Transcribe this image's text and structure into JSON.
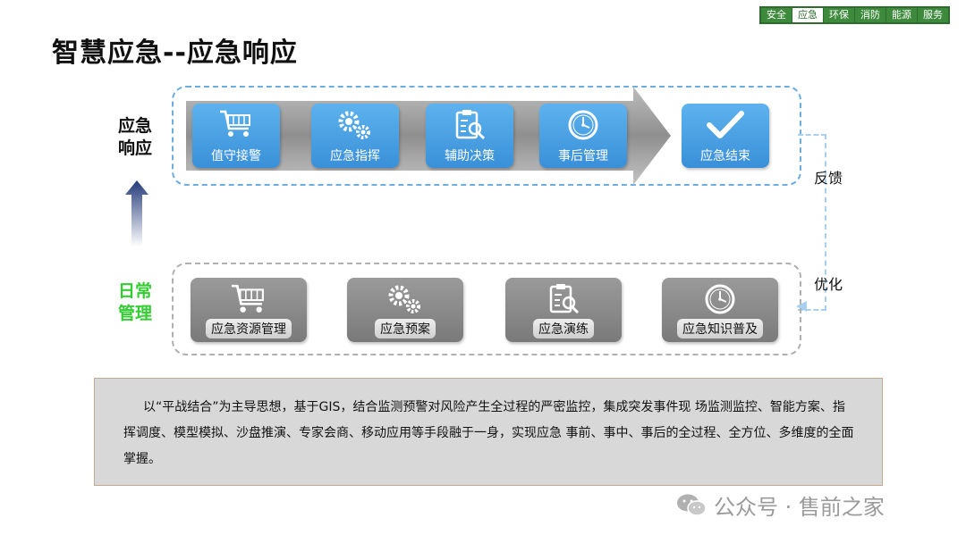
{
  "header": {
    "title": "智慧应急--应急响应",
    "tabs": [
      "安全",
      "应急",
      "环保",
      "消防",
      "能源",
      "服务"
    ],
    "active_tab": "应急"
  },
  "response": {
    "label_line1": "应急",
    "label_line2": "响应",
    "steps": [
      {
        "label": "值守接警",
        "icon": "shopping-cart-icon"
      },
      {
        "label": "应急指挥",
        "icon": "gears-icon"
      },
      {
        "label": "辅助决策",
        "icon": "clipboard-search-icon"
      },
      {
        "label": "事后管理",
        "icon": "clock-icon"
      },
      {
        "label": "应急结束",
        "icon": "checkmark-icon"
      }
    ]
  },
  "daily": {
    "label_line1": "日常",
    "label_line2": "管理",
    "steps": [
      {
        "label": "应急资源管理",
        "icon": "shopping-cart-icon"
      },
      {
        "label": "应急预案",
        "icon": "gears-icon"
      },
      {
        "label": "应急演练",
        "icon": "clipboard-search-icon"
      },
      {
        "label": "应急知识普及",
        "icon": "clock-icon"
      }
    ]
  },
  "loop": {
    "feedback": "反馈",
    "optimize": "优化"
  },
  "description": "以“平战结合”为主导思想，基于GIS，结合监测预警对风险产生全过程的严密监控，集成突发事件现 场监测监控、智能方案、指挥调度、模型模拟、沙盘推演、专家会商、移动应用等手段融于一身，实现应急 事前、事中、事后的全过程、全方位、多维度的全面掌握。",
  "watermark": "公众号 · 售前之家",
  "colors": {
    "accent_blue": "#3a90d8",
    "green_label": "#33cc33",
    "tab_green": "#3d8a3d"
  }
}
